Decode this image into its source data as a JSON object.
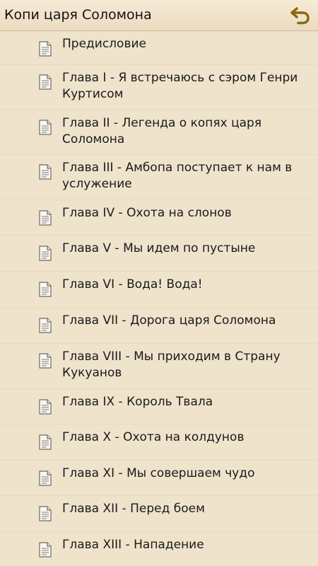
{
  "header": {
    "title": "Копи царя Соломона",
    "back_icon": "back-arrow-icon",
    "accent_color": "#8a6a10"
  },
  "chapters": [
    {
      "label": "Предисловие"
    },
    {
      "label": "Глава I - Я встречаюсь с сэром Генри Куртисом"
    },
    {
      "label": "Глава II - Легенда о копях царя Соломона"
    },
    {
      "label": "Глава III - Амбопа поступает к нам в услужение"
    },
    {
      "label": "Глава IV - Охота на слонов"
    },
    {
      "label": "Глава V - Мы идем по пустыне"
    },
    {
      "label": "Глава VI - Вода! Вода!"
    },
    {
      "label": "Глава VII - Дорога царя Соломона"
    },
    {
      "label": "Глава VIII - Мы приходим в Страну Кукуанов"
    },
    {
      "label": "Глава IX - Король Твала"
    },
    {
      "label": "Глава X - Охота на колдунов"
    },
    {
      "label": "Глава XI - Мы совершаем чудо"
    },
    {
      "label": "Глава XII - Перед боем"
    },
    {
      "label": "Глава XIII - Нападение"
    }
  ],
  "item_icon": "document-icon"
}
